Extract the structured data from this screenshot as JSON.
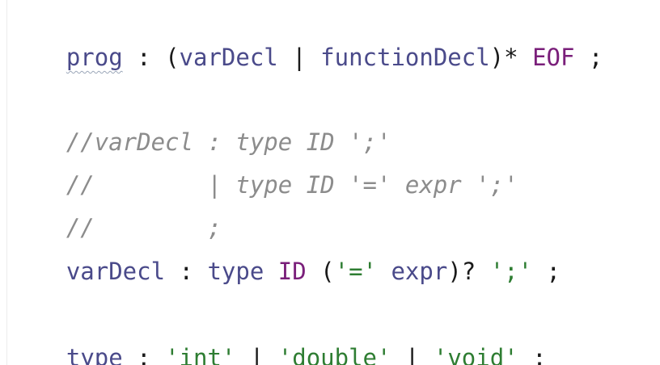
{
  "editor": {
    "lines": [
      {
        "tokens": [
          {
            "text": "prog",
            "kind": "rule"
          },
          {
            "text": " : ",
            "kind": "op"
          },
          {
            "text": "(",
            "kind": "op"
          },
          {
            "text": "varDecl",
            "kind": "rule"
          },
          {
            "text": " | ",
            "kind": "op"
          },
          {
            "text": "functionDecl",
            "kind": "rule"
          },
          {
            "text": ")*",
            "kind": "op"
          },
          {
            "text": " ",
            "kind": "op"
          },
          {
            "text": "EOF",
            "kind": "lexer"
          },
          {
            "text": " ;",
            "kind": "op"
          }
        ]
      },
      {
        "tokens": [
          {
            "text": "//varDecl : type ID ';'",
            "kind": "comment"
          }
        ]
      },
      {
        "tokens": [
          {
            "text": "//        | type ID '=' expr ';'",
            "kind": "comment"
          }
        ]
      },
      {
        "tokens": [
          {
            "text": "//        ;",
            "kind": "comment"
          }
        ]
      },
      {
        "tokens": [
          {
            "text": "varDecl",
            "kind": "rule"
          },
          {
            "text": " : ",
            "kind": "op"
          },
          {
            "text": "type",
            "kind": "rule"
          },
          {
            "text": " ",
            "kind": "op"
          },
          {
            "text": "ID",
            "kind": "lexer"
          },
          {
            "text": " (",
            "kind": "op"
          },
          {
            "text": "'='",
            "kind": "str"
          },
          {
            "text": " ",
            "kind": "op"
          },
          {
            "text": "expr",
            "kind": "rule"
          },
          {
            "text": ")? ",
            "kind": "op"
          },
          {
            "text": "';'",
            "kind": "str"
          },
          {
            "text": " ;",
            "kind": "op"
          }
        ]
      },
      {
        "tokens": [
          {
            "text": "type",
            "kind": "rule"
          },
          {
            "text": " : ",
            "kind": "op"
          },
          {
            "text": "'int'",
            "kind": "str"
          },
          {
            "text": " | ",
            "kind": "op"
          },
          {
            "text": "'double'",
            "kind": "str"
          },
          {
            "text": " | ",
            "kind": "op"
          },
          {
            "text": "'void'",
            "kind": "str"
          },
          {
            "text": " ;",
            "kind": "op"
          }
        ]
      }
    ]
  }
}
